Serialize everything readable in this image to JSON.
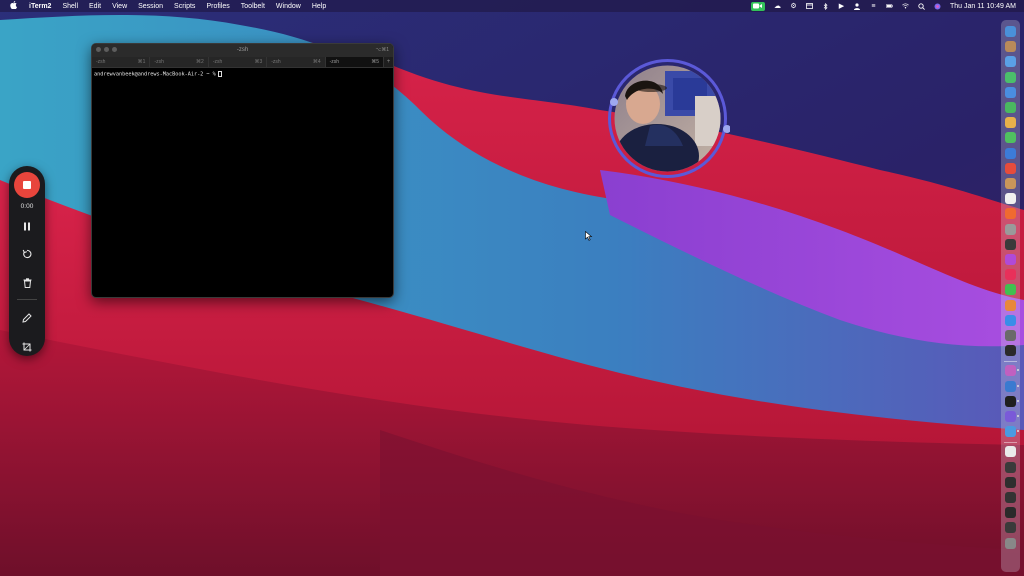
{
  "menubar": {
    "apple_icon": "apple-icon",
    "app_name": "iTerm2",
    "menus": [
      "Shell",
      "Edit",
      "View",
      "Session",
      "Scripts",
      "Profiles",
      "Toolbelt",
      "Window",
      "Help"
    ],
    "clock": "Thu Jan 11  10:49 AM",
    "status_icons": [
      "camera-recording-icon",
      "cloud-icon",
      "gear-icon",
      "window-icon",
      "bluetooth-icon",
      "play-icon",
      "user-icon",
      "control-center-icon",
      "battery-icon",
      "wifi-icon",
      "search-icon",
      "siri-icon",
      "display-icon"
    ],
    "camera_color": "#32c25a"
  },
  "terminal": {
    "title": "-zsh",
    "title_shortcut": "⌥⌘1",
    "tabs": [
      {
        "label": "-zsh",
        "shortcut": "⌘1"
      },
      {
        "label": "-zsh",
        "shortcut": "⌘2"
      },
      {
        "label": "-zsh",
        "shortcut": "⌘3"
      },
      {
        "label": "-zsh",
        "shortcut": "⌘4"
      },
      {
        "label": "-zsh",
        "shortcut": "⌘5"
      }
    ],
    "add_tab": "+",
    "prompt": "andrewvanbeek@andrews-MacBook-Air-2 ~ %"
  },
  "recorder": {
    "time": "0:00",
    "stop_color": "#e8453c",
    "icons": [
      "stop-icon",
      "pause-icon",
      "restart-icon",
      "trash-icon",
      "pen-icon",
      "crop-icon"
    ]
  },
  "webcam": {
    "icon": "webcam-bubble",
    "ring_color": "#7a62e8"
  },
  "dock": {
    "colors": [
      "#4a90d9",
      "#b98a5a",
      "#5aa0e6",
      "#4bbf6b",
      "#4a8de0",
      "#4ab860",
      "#e8b04a",
      "#50c060",
      "#3c7bd8",
      "#e64c3c",
      "#c9965a",
      "#f0f0f0",
      "#f06a30",
      "#9a9a9a",
      "#3a3a3a",
      "#b04ad8",
      "#e8305a",
      "#40c050",
      "#e8883a",
      "#3a8de8",
      "#6a6a6a",
      "#2a2a2a",
      "#c060c0",
      "#3a7ad0",
      "#1f1f1f",
      "#7a5ad8",
      "#4a9ae0",
      "#eaeaea",
      "#3a3a3a",
      "#2e2e2e",
      "#333333",
      "#2a2a2a",
      "#3a3a3a",
      "#888888"
    ]
  }
}
